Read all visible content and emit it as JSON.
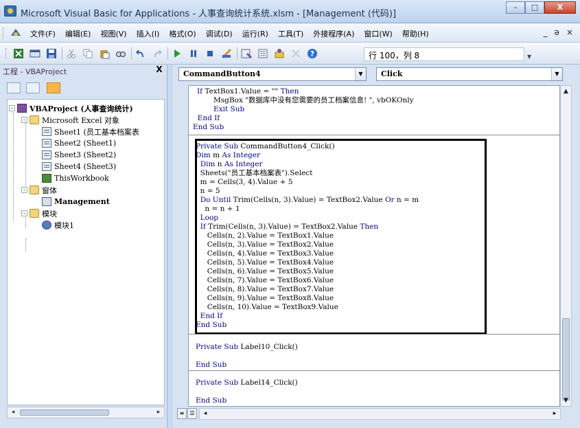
{
  "window": {
    "title": "Microsoft Visual Basic for Applications - 人事查询统计系统.xlsm - [Management (代码)]",
    "minimize_label": "–",
    "maximize_label": "□",
    "close_label": "X"
  },
  "menu": {
    "items": [
      "文件(F)",
      "编辑(E)",
      "视图(V)",
      "插入(I)",
      "格式(O)",
      "调试(D)",
      "运行(R)",
      "工具(T)",
      "外接程序(A)",
      "窗口(W)",
      "帮助(H)"
    ],
    "mdi_minimize": "_",
    "mdi_restore": "ǝ",
    "mdi_close": "×"
  },
  "toolbar": {
    "position": "行 100，列 8"
  },
  "project": {
    "title": "工程 - VBAProject",
    "close": "X",
    "tree": [
      "VBAProject (人事查询统计)",
      "Microsoft Excel 对象",
      "Sheet1 (员工基本档案表",
      "Sheet2 (Sheet1)",
      "Sheet3 (Sheet2)",
      "Sheet4 (Sheet3)",
      "ThisWorkbook",
      "窗体",
      "Management",
      "模块",
      "模块1"
    ]
  },
  "code": {
    "object_combo": "CommandButton4",
    "proc_combo": "Click",
    "lines": [
      "  If TextBox1.Value = \"\" Then",
      "         MsgBox \"数据库中没有您需要的员工档案信息! \", vbOKOnly",
      "         Exit Sub",
      "  End If",
      "End Sub",
      "Private Sub CommandButton4_Click()",
      "Dim m As Integer",
      "  Dim n As Integer",
      "  Sheets(\"员工基本档案表\").Select",
      "  m = Cells(3, 4).Value + 5",
      "  n = 5",
      "  Do Until Trim(Cells(n, 3).Value) = TextBox2.Value Or n = m",
      "    n = n + 1",
      "  Loop",
      "  If Trim(Cells(n, 3).Value) = TextBox2.Value Then",
      "     Cells(n, 2).Value = TextBox1.Value",
      "     Cells(n, 3).Value = TextBox2.Value",
      "     Cells(n, 4).Value = TextBox3.Value",
      "     Cells(n, 5).Value = TextBox4.Value",
      "     Cells(n, 6).Value = TextBox5.Value",
      "     Cells(n, 7).Value = TextBox6.Value",
      "     Cells(n, 8).Value = TextBox7.Value",
      "     Cells(n, 9).Value = TextBox8.Value",
      "     Cells(n, 10).Value = TextBox9.Value",
      "  End If",
      "End Sub",
      "Private Sub Label10_Click()",
      "End Sub",
      "Private Sub Label14_Click()",
      "End Sub"
    ]
  }
}
